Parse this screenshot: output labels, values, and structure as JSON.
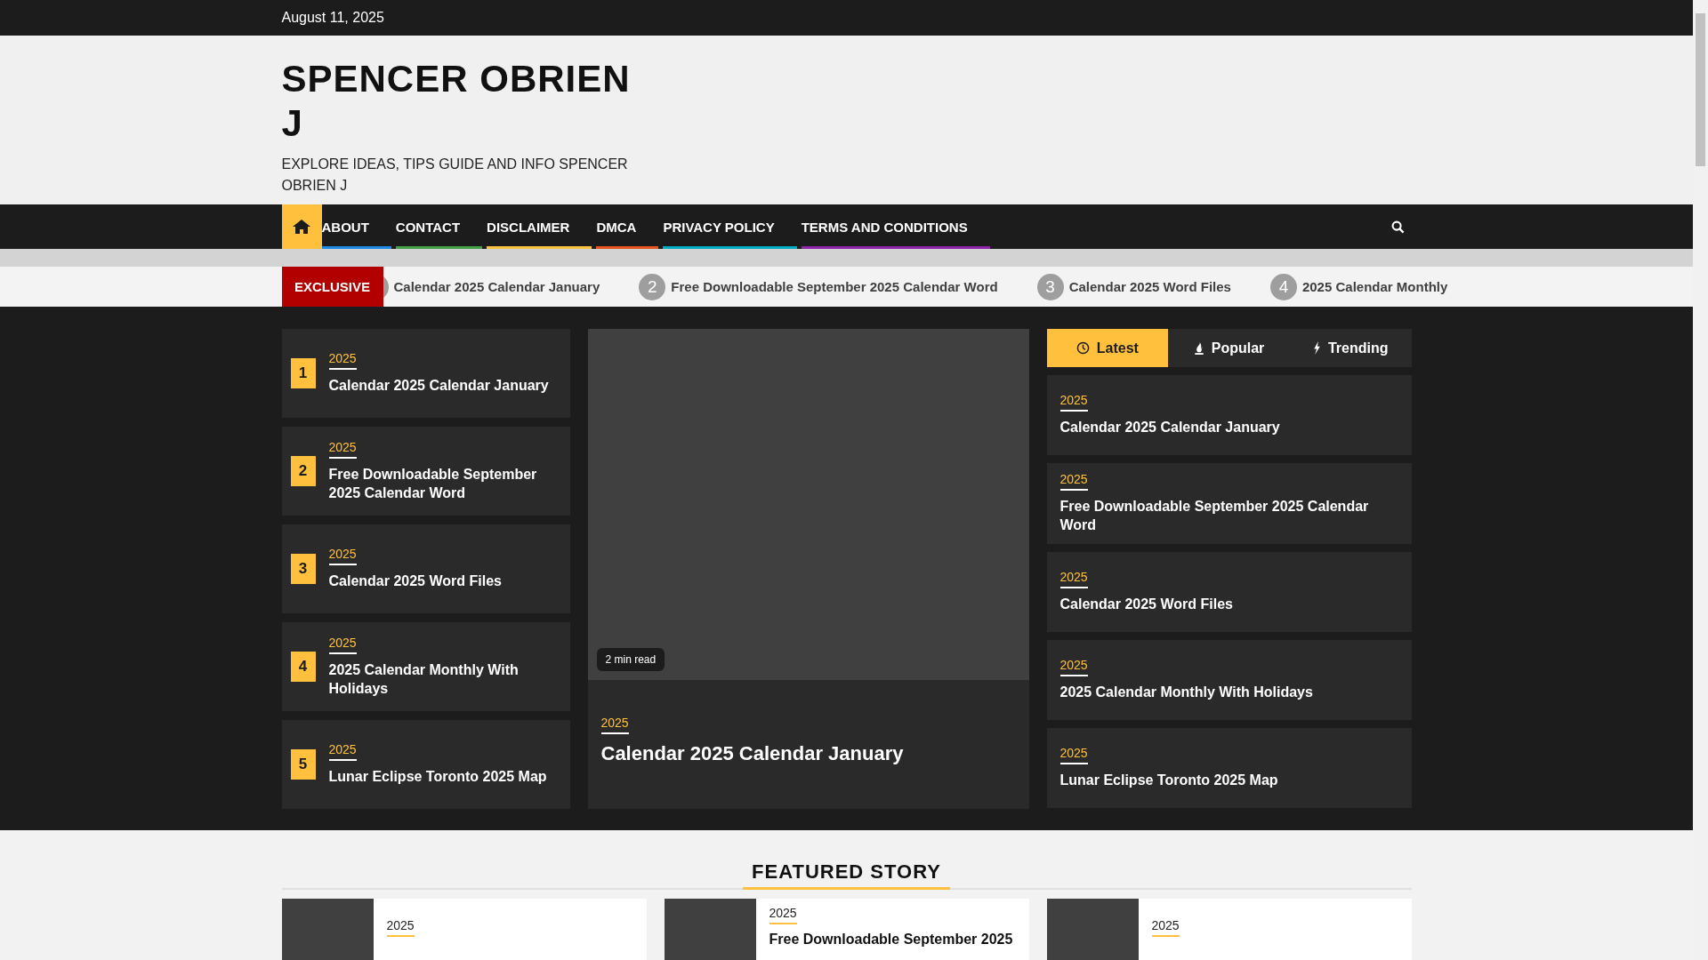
{
  "top_bar": {
    "date": "August 11, 2025"
  },
  "header": {
    "site_title": "SPENCER OBRIEN J",
    "tagline": "EXPLORE IDEAS, TIPS GUIDE AND INFO SPENCER OBRIEN J"
  },
  "nav": {
    "items": [
      {
        "label": "ABOUT",
        "color": "#1e88e5"
      },
      {
        "label": "CONTACT",
        "color": "#43a047"
      },
      {
        "label": "DISCLAIMER",
        "color": "#f9c440"
      },
      {
        "label": "DMCA",
        "color": "#e8541e"
      },
      {
        "label": "PRIVACY POLICY",
        "color": "#00acc1"
      },
      {
        "label": "TERMS AND CONDITIONS",
        "color": "#8e24aa"
      }
    ]
  },
  "ticker": {
    "label": "EXCLUSIVE",
    "items": [
      {
        "title": "Calendar 2025 Calendar January"
      },
      {
        "number": "2",
        "title": "Free Downloadable September 2025 Calendar Word"
      },
      {
        "number": "3",
        "title": "Calendar 2025 Word Files"
      },
      {
        "number": "4",
        "title": "2025 Calendar Monthly"
      }
    ]
  },
  "ranked_list": [
    {
      "number": "1",
      "category": "2025",
      "title": "Calendar 2025 Calendar January"
    },
    {
      "number": "2",
      "category": "2025",
      "title": "Free Downloadable September 2025 Calendar Word"
    },
    {
      "number": "3",
      "category": "2025",
      "title": "Calendar 2025 Word Files"
    },
    {
      "number": "4",
      "category": "2025",
      "title": "2025 Calendar Monthly With Holidays"
    },
    {
      "number": "5",
      "category": "2025",
      "title": "Lunar Eclipse Toronto 2025 Map"
    }
  ],
  "hero": {
    "read_time": "2 min read",
    "category": "2025",
    "title": "Calendar 2025 Calendar January"
  },
  "tabs": [
    {
      "label": "Latest",
      "kind": "clock",
      "selected": true
    },
    {
      "label": "Popular",
      "kind": "flame",
      "selected": false
    },
    {
      "label": "Trending",
      "kind": "bolt",
      "selected": false
    }
  ],
  "tab_posts": [
    {
      "category": "2025",
      "title": "Calendar 2025 Calendar January"
    },
    {
      "category": "2025",
      "title": "Free Downloadable September 2025 Calendar Word"
    },
    {
      "category": "2025",
      "title": "Calendar 2025 Word Files"
    },
    {
      "category": "2025",
      "title": "2025 Calendar Monthly With Holidays"
    },
    {
      "category": "2025",
      "title": "Lunar Eclipse Toronto 2025 Map"
    }
  ],
  "featured": {
    "title": "FEATURED STORY",
    "cards": [
      {
        "category": "2025"
      },
      {
        "category": "2025",
        "title": "Free Downloadable September 2025"
      },
      {
        "category": "2025"
      }
    ]
  }
}
